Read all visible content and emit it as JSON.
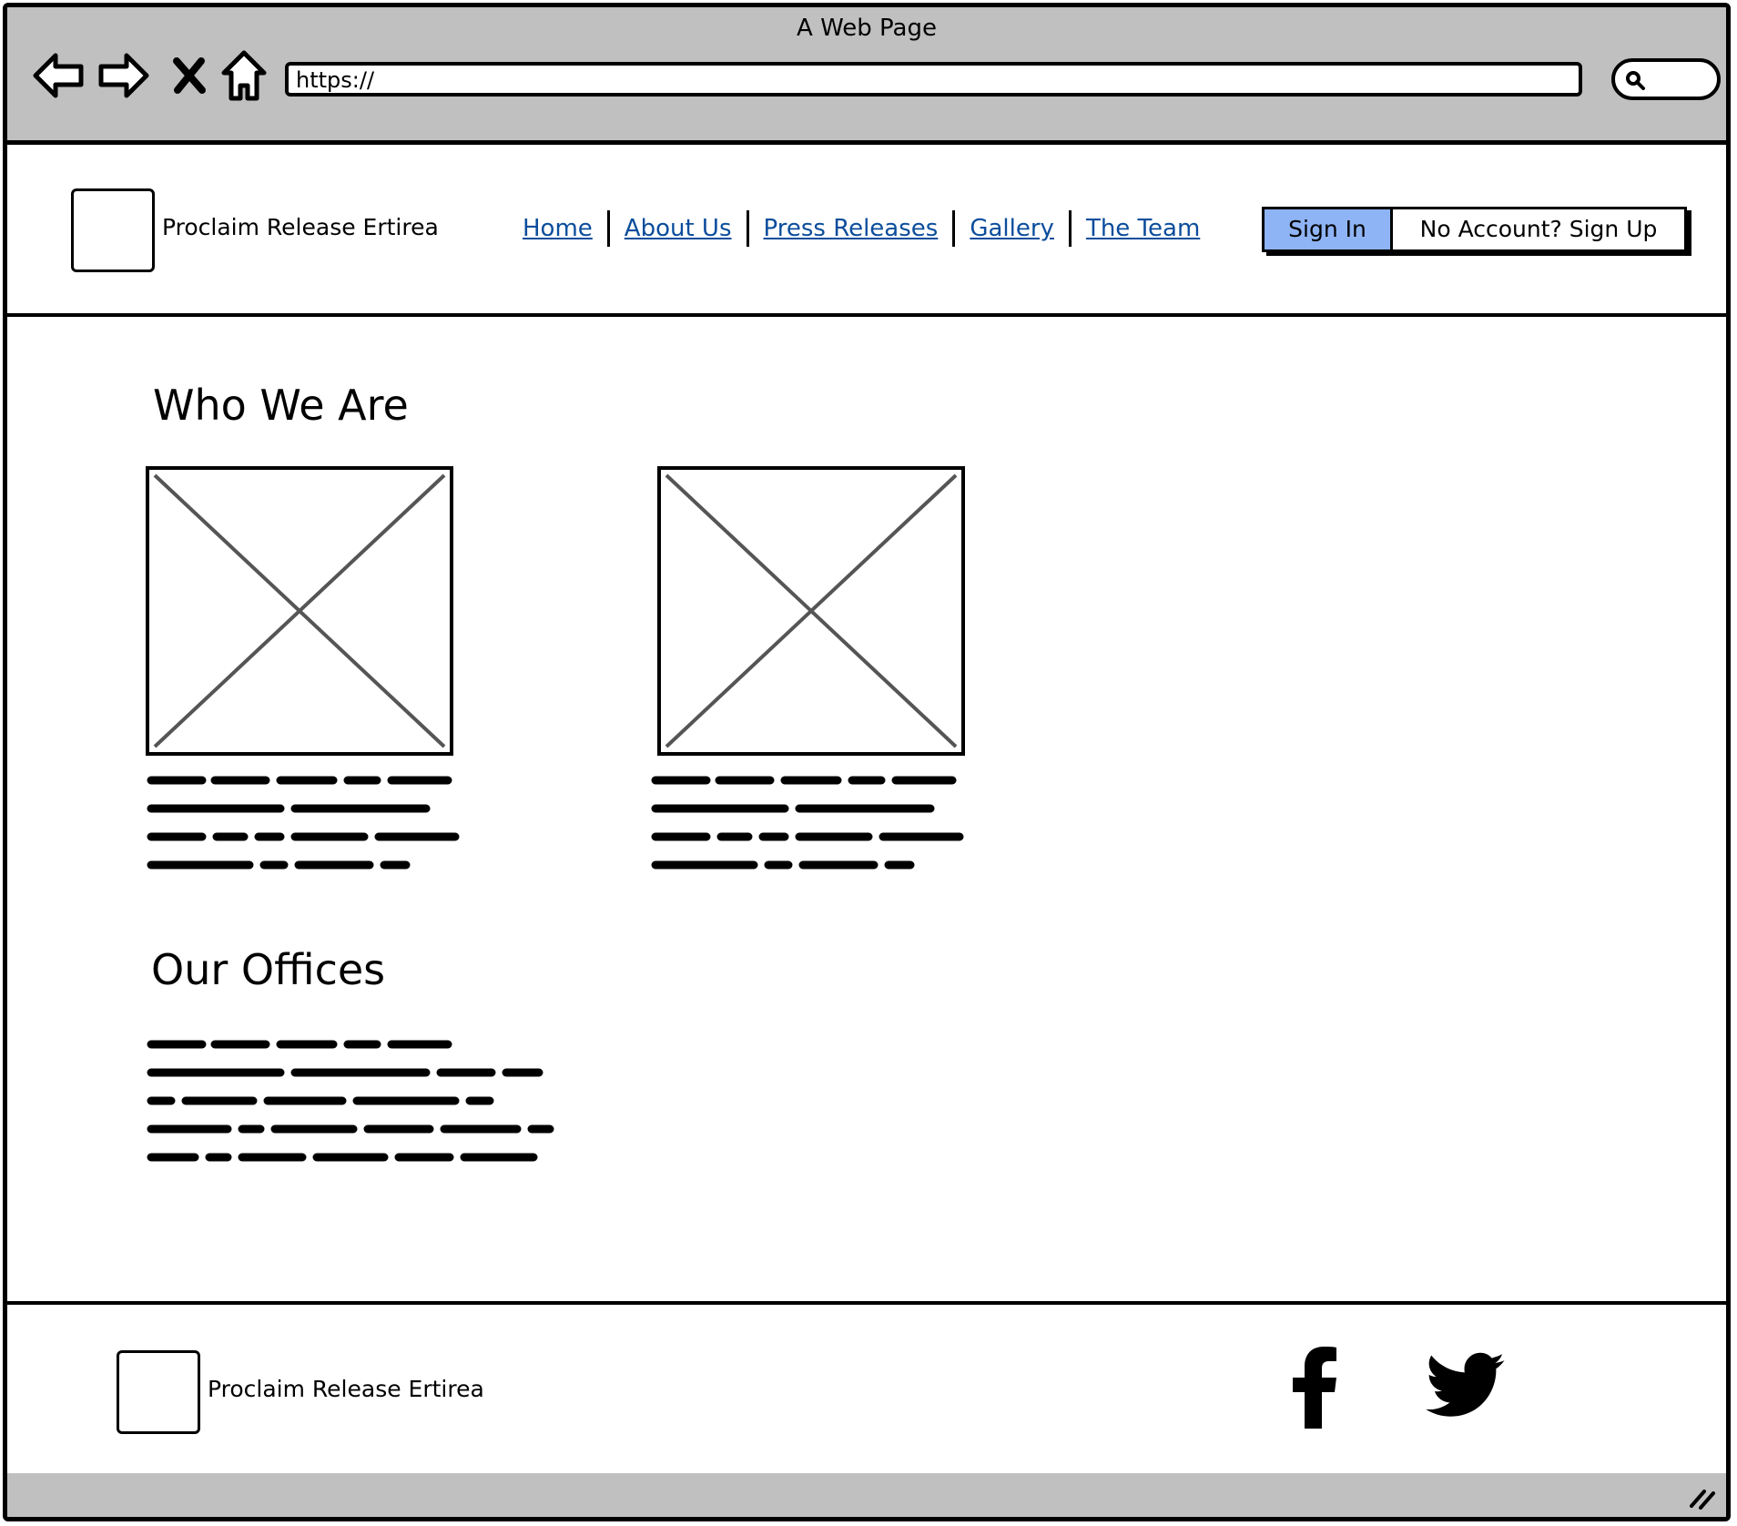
{
  "window": {
    "title": "A Web Page",
    "url": "https://",
    "nav_icons": [
      "back-arrow-icon",
      "forward-arrow-icon",
      "stop-icon",
      "home-icon",
      "search-icon"
    ]
  },
  "header": {
    "brand_name": "Proclaim Release Ertirea",
    "nav_links": [
      "Home",
      "About Us",
      "Press Releases",
      "Gallery",
      "The Team"
    ],
    "sign_in": "Sign In",
    "sign_up": "No Account? Sign Up"
  },
  "main": {
    "who_we_are_title": "Who We Are",
    "offices_title": "Our Offices"
  },
  "footer": {
    "brand_name": "Proclaim Release Ertirea",
    "social_icons": [
      "facebook-icon",
      "twitter-icon"
    ]
  },
  "colors": {
    "chrome": "#c0c0c0",
    "link": "#0b4d9c",
    "sign_in_bg": "#8fb4f5",
    "placeholder_stroke": "#555555"
  }
}
